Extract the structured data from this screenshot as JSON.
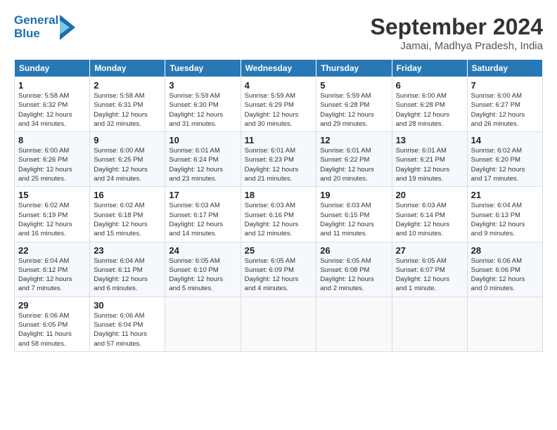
{
  "logo": {
    "line1": "General",
    "line2": "Blue"
  },
  "title": "September 2024",
  "location": "Jamai, Madhya Pradesh, India",
  "days_of_week": [
    "Sunday",
    "Monday",
    "Tuesday",
    "Wednesday",
    "Thursday",
    "Friday",
    "Saturday"
  ],
  "weeks": [
    [
      {
        "day": "1",
        "info": "Sunrise: 5:58 AM\nSunset: 6:32 PM\nDaylight: 12 hours\nand 34 minutes."
      },
      {
        "day": "2",
        "info": "Sunrise: 5:58 AM\nSunset: 6:31 PM\nDaylight: 12 hours\nand 32 minutes."
      },
      {
        "day": "3",
        "info": "Sunrise: 5:59 AM\nSunset: 6:30 PM\nDaylight: 12 hours\nand 31 minutes."
      },
      {
        "day": "4",
        "info": "Sunrise: 5:59 AM\nSunset: 6:29 PM\nDaylight: 12 hours\nand 30 minutes."
      },
      {
        "day": "5",
        "info": "Sunrise: 5:59 AM\nSunset: 6:28 PM\nDaylight: 12 hours\nand 29 minutes."
      },
      {
        "day": "6",
        "info": "Sunrise: 6:00 AM\nSunset: 6:28 PM\nDaylight: 12 hours\nand 28 minutes."
      },
      {
        "day": "7",
        "info": "Sunrise: 6:00 AM\nSunset: 6:27 PM\nDaylight: 12 hours\nand 26 minutes."
      }
    ],
    [
      {
        "day": "8",
        "info": "Sunrise: 6:00 AM\nSunset: 6:26 PM\nDaylight: 12 hours\nand 25 minutes."
      },
      {
        "day": "9",
        "info": "Sunrise: 6:00 AM\nSunset: 6:25 PM\nDaylight: 12 hours\nand 24 minutes."
      },
      {
        "day": "10",
        "info": "Sunrise: 6:01 AM\nSunset: 6:24 PM\nDaylight: 12 hours\nand 23 minutes."
      },
      {
        "day": "11",
        "info": "Sunrise: 6:01 AM\nSunset: 6:23 PM\nDaylight: 12 hours\nand 21 minutes."
      },
      {
        "day": "12",
        "info": "Sunrise: 6:01 AM\nSunset: 6:22 PM\nDaylight: 12 hours\nand 20 minutes."
      },
      {
        "day": "13",
        "info": "Sunrise: 6:01 AM\nSunset: 6:21 PM\nDaylight: 12 hours\nand 19 minutes."
      },
      {
        "day": "14",
        "info": "Sunrise: 6:02 AM\nSunset: 6:20 PM\nDaylight: 12 hours\nand 17 minutes."
      }
    ],
    [
      {
        "day": "15",
        "info": "Sunrise: 6:02 AM\nSunset: 6:19 PM\nDaylight: 12 hours\nand 16 minutes."
      },
      {
        "day": "16",
        "info": "Sunrise: 6:02 AM\nSunset: 6:18 PM\nDaylight: 12 hours\nand 15 minutes."
      },
      {
        "day": "17",
        "info": "Sunrise: 6:03 AM\nSunset: 6:17 PM\nDaylight: 12 hours\nand 14 minutes."
      },
      {
        "day": "18",
        "info": "Sunrise: 6:03 AM\nSunset: 6:16 PM\nDaylight: 12 hours\nand 12 minutes."
      },
      {
        "day": "19",
        "info": "Sunrise: 6:03 AM\nSunset: 6:15 PM\nDaylight: 12 hours\nand 11 minutes."
      },
      {
        "day": "20",
        "info": "Sunrise: 6:03 AM\nSunset: 6:14 PM\nDaylight: 12 hours\nand 10 minutes."
      },
      {
        "day": "21",
        "info": "Sunrise: 6:04 AM\nSunset: 6:13 PM\nDaylight: 12 hours\nand 9 minutes."
      }
    ],
    [
      {
        "day": "22",
        "info": "Sunrise: 6:04 AM\nSunset: 6:12 PM\nDaylight: 12 hours\nand 7 minutes."
      },
      {
        "day": "23",
        "info": "Sunrise: 6:04 AM\nSunset: 6:11 PM\nDaylight: 12 hours\nand 6 minutes."
      },
      {
        "day": "24",
        "info": "Sunrise: 6:05 AM\nSunset: 6:10 PM\nDaylight: 12 hours\nand 5 minutes."
      },
      {
        "day": "25",
        "info": "Sunrise: 6:05 AM\nSunset: 6:09 PM\nDaylight: 12 hours\nand 4 minutes."
      },
      {
        "day": "26",
        "info": "Sunrise: 6:05 AM\nSunset: 6:08 PM\nDaylight: 12 hours\nand 2 minutes."
      },
      {
        "day": "27",
        "info": "Sunrise: 6:05 AM\nSunset: 6:07 PM\nDaylight: 12 hours\nand 1 minute."
      },
      {
        "day": "28",
        "info": "Sunrise: 6:06 AM\nSunset: 6:06 PM\nDaylight: 12 hours\nand 0 minutes."
      }
    ],
    [
      {
        "day": "29",
        "info": "Sunrise: 6:06 AM\nSunset: 6:05 PM\nDaylight: 11 hours\nand 58 minutes."
      },
      {
        "day": "30",
        "info": "Sunrise: 6:06 AM\nSunset: 6:04 PM\nDaylight: 11 hours\nand 57 minutes."
      },
      {
        "day": "",
        "info": ""
      },
      {
        "day": "",
        "info": ""
      },
      {
        "day": "",
        "info": ""
      },
      {
        "day": "",
        "info": ""
      },
      {
        "day": "",
        "info": ""
      }
    ]
  ]
}
